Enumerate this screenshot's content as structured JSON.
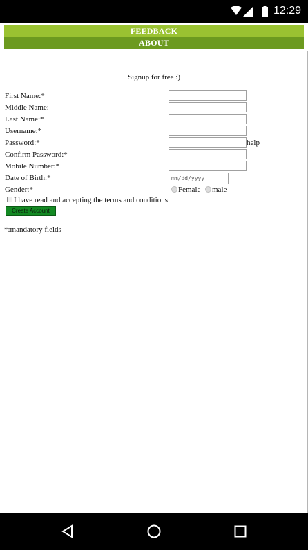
{
  "status_bar": {
    "time": "12:29",
    "icons": [
      "wifi-icon",
      "signal-icon",
      "battery-icon"
    ]
  },
  "nav": {
    "feedback": "FEEDBACK",
    "about": "ABOUT",
    "colors": {
      "feedback": "#9ac231",
      "about": "#6c9a1f"
    }
  },
  "form": {
    "heading": "Signup for free :)",
    "fields": {
      "first_name": "First Name:*",
      "middle_name": "Middle Name:",
      "last_name": "Last Name:*",
      "username": "Username:*",
      "password": "Password:*",
      "password_help": "help",
      "confirm_password": "Confirm Password:*",
      "mobile": "Mobile Number:*",
      "dob": "Date of Birth:*",
      "dob_placeholder": "mm/dd/yyyy",
      "gender": "Gender:*",
      "gender_options": [
        "Female",
        "male"
      ]
    },
    "terms": "I have read and accepting the terms and conditions",
    "submit": "Create Account",
    "submit_color": "#138a23",
    "mandatory_note": "*:mandatory fields"
  },
  "android_nav": {
    "back": "back-icon",
    "home": "home-icon",
    "recents": "recents-icon"
  }
}
